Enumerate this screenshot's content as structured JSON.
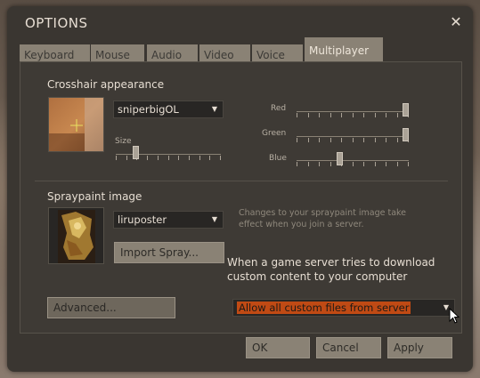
{
  "window": {
    "title": "OPTIONS",
    "close_symbol": "✕"
  },
  "tabs": [
    {
      "label": "Keyboard",
      "active": false
    },
    {
      "label": "Mouse",
      "active": false
    },
    {
      "label": "Audio",
      "active": false
    },
    {
      "label": "Video",
      "active": false
    },
    {
      "label": "Voice",
      "active": false
    },
    {
      "label": "Multiplayer",
      "active": true
    }
  ],
  "crosshair": {
    "heading": "Crosshair appearance",
    "selected": "sniperbigOL",
    "size_label": "Size",
    "size_value": 0.17,
    "red_label": "Red",
    "green_label": "Green",
    "blue_label": "Blue",
    "red_value": 1.0,
    "green_value": 1.0,
    "blue_value": 0.38,
    "preview_icon": "crosshair-preview"
  },
  "spray": {
    "heading": "Spraypaint image",
    "selected": "liruposter",
    "import_label": "Import Spray...",
    "hint": "Changes to your spraypaint image take effect when you join a server.",
    "preview_icon": "spray-preview"
  },
  "download": {
    "label": "When a game server tries to download custom content to your computer",
    "selected": "Allow all custom files from server"
  },
  "buttons": {
    "advanced": "Advanced...",
    "ok": "OK",
    "cancel": "Cancel",
    "apply": "Apply"
  },
  "colors": {
    "dialog": "#3a3631",
    "tab": "#8a8275",
    "highlight": "#c04a14"
  }
}
